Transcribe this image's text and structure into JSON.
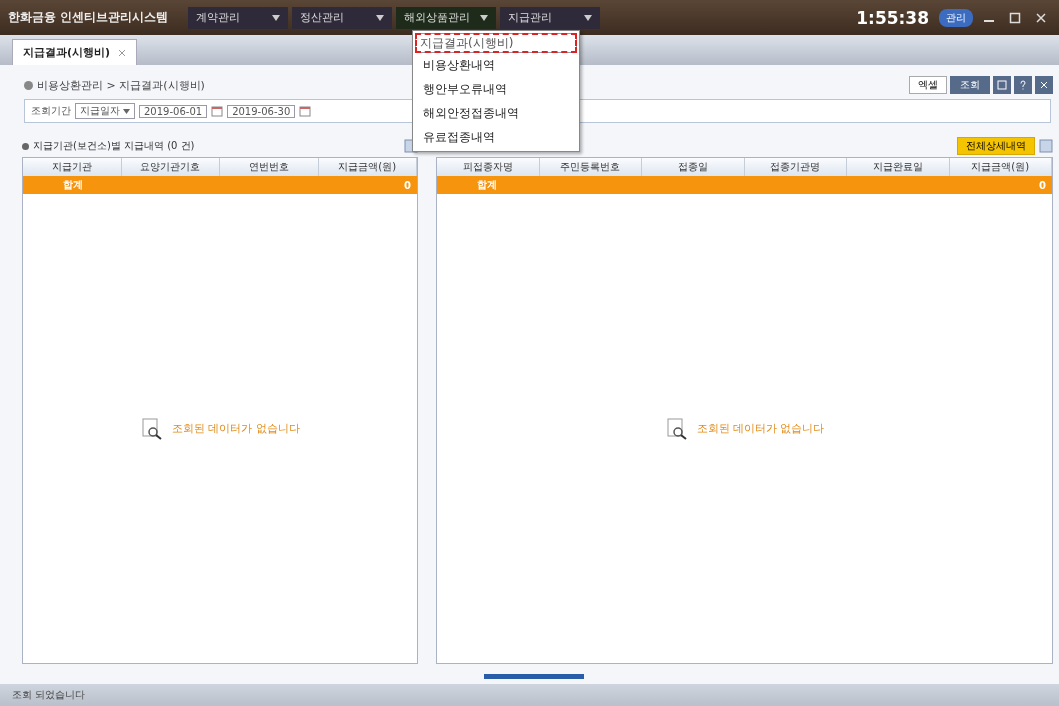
{
  "window": {
    "title": "한화금융 인센티브관리시스템",
    "time": "1:55:38",
    "user_badge": "관리"
  },
  "menus": [
    {
      "label": "계약관리",
      "expanded": false
    },
    {
      "label": "정산관리",
      "expanded": false
    },
    {
      "label": "해외상품관리",
      "expanded": true
    },
    {
      "label": "지급관리",
      "expanded": false
    }
  ],
  "dropdown": [
    {
      "label": "지급결과(시행비)",
      "selected": true
    },
    {
      "label": "비용상환내역",
      "selected": false
    },
    {
      "label": "행안부오류내역",
      "selected": false
    },
    {
      "label": "해외안정접종내역",
      "selected": false
    },
    {
      "label": "유료접종내역",
      "selected": false
    }
  ],
  "tabs": [
    {
      "label": "지급결과(시행비)",
      "selected": true
    }
  ],
  "breadcrumb": "비용상환관리 > 지급결과(시행비)",
  "toolbar": {
    "excel": "엑셀",
    "search": "조회"
  },
  "filter": {
    "label": "조회기간",
    "select": "지급일자",
    "from": "2019-06-01",
    "to": "2019-06-30"
  },
  "left_panel": {
    "title": "지급기관(보건소)별 지급내역 (0 건)",
    "columns": [
      "지급기관",
      "요양기관기호",
      "연번번호",
      "지급금액(원)"
    ],
    "total": [
      "합계",
      "0"
    ],
    "empty": "조회된 데이터가 없습니다"
  },
  "right_panel": {
    "button": "전체상세내역",
    "columns": [
      "피접종자명",
      "주민등록번호",
      "접종일",
      "접종기관명",
      "지급완료일",
      "지급금액(원)"
    ],
    "total": [
      "합계",
      "0"
    ],
    "empty": "조회된 데이터가 없습니다"
  },
  "status_bar": "조회 되었습니다"
}
